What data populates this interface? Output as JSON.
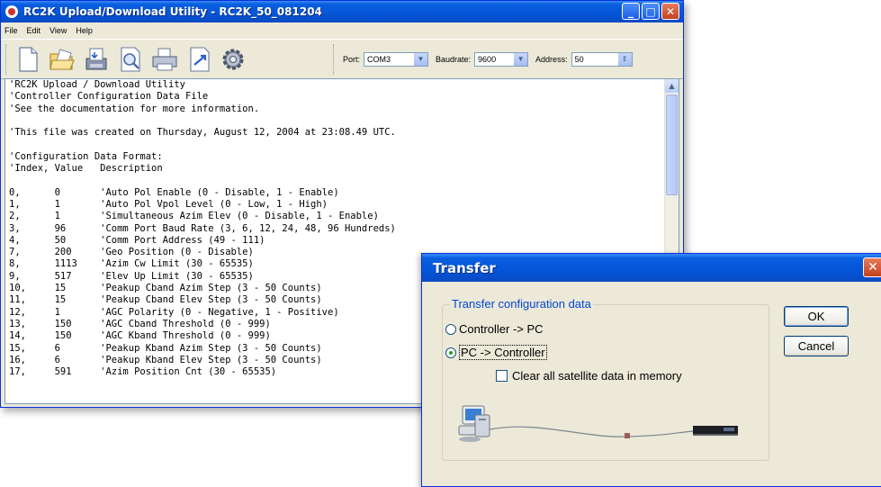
{
  "window": {
    "title": "RC2K Upload/Download Utility - RC2K_50_081204",
    "buttons": {
      "minimize": "_",
      "maximize": "□",
      "close": "✕"
    }
  },
  "menu": [
    "File",
    "Edit",
    "View",
    "Help"
  ],
  "toolbar": {
    "tools": [
      "new-file-icon",
      "open-folder-icon",
      "save-disk-icon",
      "print-preview-icon",
      "printer-icon",
      "transfer-arrow-icon",
      "settings-gear-icon"
    ],
    "port_label": "Port:",
    "port_value": "COM3",
    "baud_label": "Baudrate:",
    "baud_value": "9600",
    "address_label": "Address:",
    "address_value": "50"
  },
  "editor": {
    "lines": [
      "'RC2K Upload / Download Utility",
      "'Controller Configuration Data File",
      "'See the documentation for more information.",
      "",
      "'This file was created on Thursday, August 12, 2004 at 23:08.49 UTC.",
      "",
      "'Configuration Data Format:",
      "'Index, Value   Description",
      "",
      "0,      0       'Auto Pol Enable (0 - Disable, 1 - Enable)",
      "1,      1       'Auto Pol Vpol Level (0 - Low, 1 - High)",
      "2,      1       'Simultaneous Azim Elev (0 - Disable, 1 - Enable)",
      "3,      96      'Comm Port Baud Rate (3, 6, 12, 24, 48, 96 Hundreds)",
      "4,      50      'Comm Port Address (49 - 111)",
      "7,      200     'Geo Position (0 - Disable)",
      "8,      1113    'Azim Cw Limit (30 - 65535)",
      "9,      517     'Elev Up Limit (30 - 65535)",
      "10,     15      'Peakup Cband Azim Step (3 - 50 Counts)",
      "11,     15      'Peakup Cband Elev Step (3 - 50 Counts)",
      "12,     1       'AGC Polarity (0 - Negative, 1 - Positive)",
      "13,     150     'AGC Cband Threshold (0 - 999)",
      "14,     150     'AGC Kband Threshold (0 - 999)",
      "15,     6       'Peakup Kband Azim Step (3 - 50 Counts)",
      "16,     6       'Peakup Kband Elev Step (3 - 50 Counts)",
      "17,     591     'Azim Position Cnt (30 - 65535)"
    ]
  },
  "dialog": {
    "title": "Transfer",
    "close": "✕",
    "group_label": "Transfer configuration data",
    "radio_controller_to_pc": "Controller -> PC",
    "radio_pc_to_controller": "PC -> Controller",
    "selected": "PC -> Controller",
    "checkbox_label": "Clear all satellite data in memory",
    "checkbox_checked": false,
    "ok": "OK",
    "cancel": "Cancel"
  }
}
